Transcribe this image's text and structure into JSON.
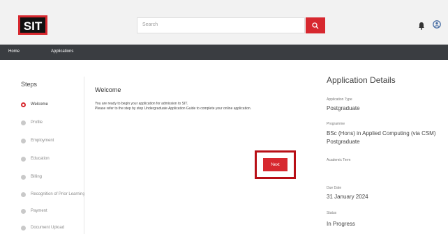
{
  "header": {
    "logo_text": "SIT",
    "search_placeholder": "Search",
    "search_icon": "search-icon",
    "bell_icon": "bell-icon",
    "user_icon": "user-icon"
  },
  "nav": {
    "home": "Home",
    "applications": "Applications"
  },
  "steps": {
    "title": "Steps",
    "items": [
      {
        "label": "Welcome",
        "active": true
      },
      {
        "label": "Profile",
        "active": false
      },
      {
        "label": "Employment",
        "active": false
      },
      {
        "label": "Education",
        "active": false
      },
      {
        "label": "Billing",
        "active": false
      },
      {
        "label": "Recognition of Prior Learning",
        "active": false
      },
      {
        "label": "Payment",
        "active": false
      },
      {
        "label": "Document Upload",
        "active": false
      }
    ]
  },
  "main": {
    "title": "Welcome",
    "line1": "You are ready to begin your application for admission to SIT.",
    "line2": "Please refer to the step by step Undergraduate Application Guide to complete your online application.",
    "next_label": "Next"
  },
  "details": {
    "title": "Application Details",
    "application_type_label": "Application Type",
    "application_type_value": "Postgraduate",
    "programme_label": "Programme",
    "programme_value_1": "BSc (Hons) in Applied Computing (via CSM)",
    "programme_value_2": "Postgraduate",
    "academic_term_label": "Academic Term",
    "due_date_label": "Due Date",
    "due_date_value": "31 January 2024",
    "status_label": "Status",
    "status_value": "In Progress"
  },
  "colors": {
    "accent": "#d7282f",
    "nav_bg": "#3a3d41",
    "header_bg": "#f2f2f2"
  }
}
